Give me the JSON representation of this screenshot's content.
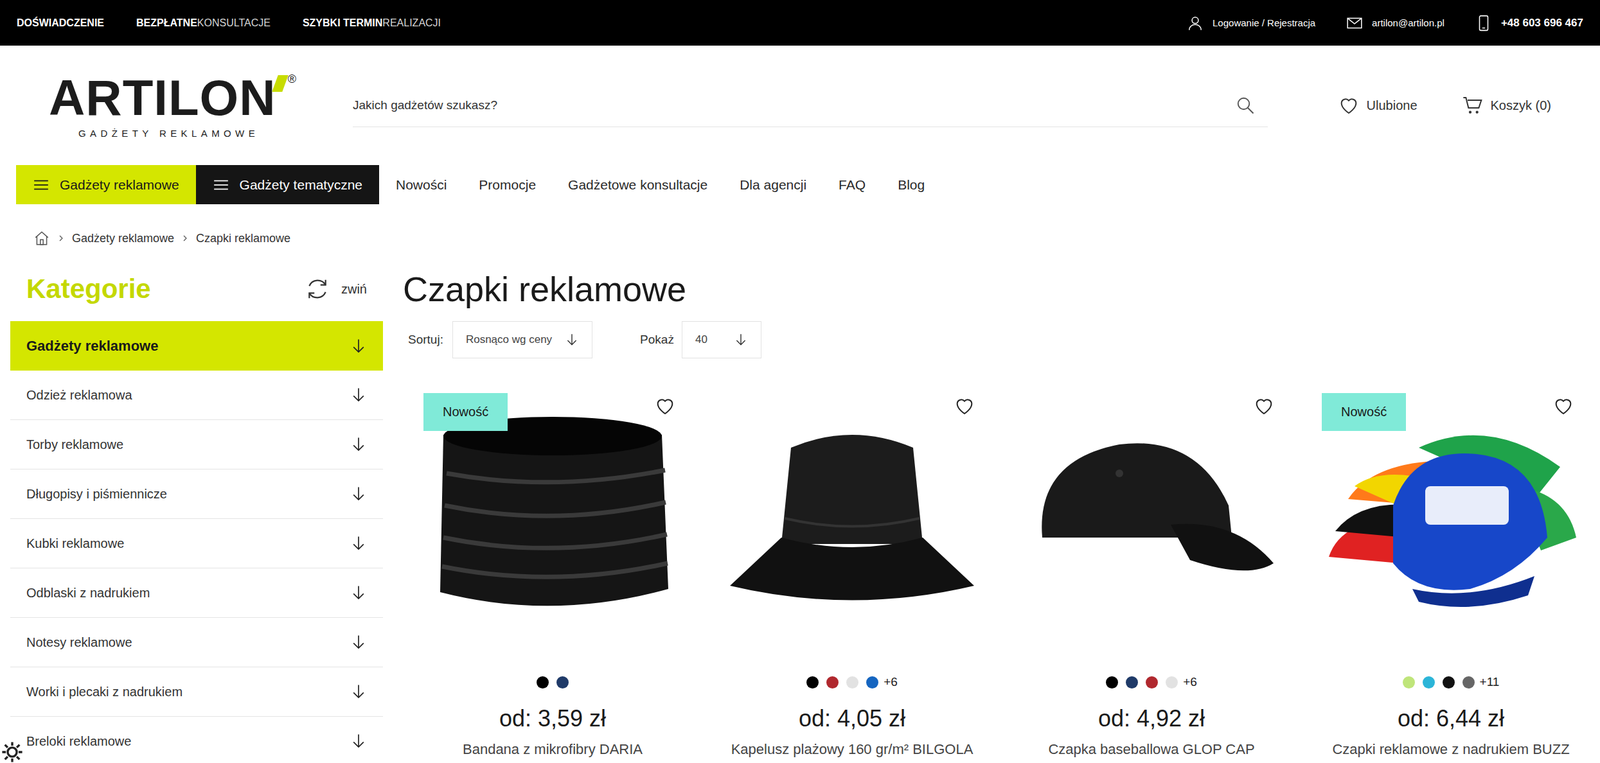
{
  "topbar": {
    "highlights": [
      {
        "bold": "DOŚWIADCZENIE"
      },
      {
        "bold": "BEZPŁATNE",
        "light": "KONSULTACJE"
      },
      {
        "bold": "SZYBKI TERMIN",
        "light": "REALIZACJI"
      }
    ],
    "login": "Logowanie / Rejestracja",
    "email": "artilon@artilon.pl",
    "phone": "+48 603 696 467"
  },
  "logo": {
    "name": "ARTILON",
    "mark": "®",
    "tagline": "GADŻETY REKLAMOWE"
  },
  "search": {
    "placeholder": "Jakich gadżetów szukasz?"
  },
  "header_actions": {
    "favorites": "Ulubione",
    "cart": "Koszyk (0)"
  },
  "nav": {
    "menus": [
      {
        "label": "Gadżety reklamowe",
        "kind": "lime"
      },
      {
        "label": "Gadżety tematyczne",
        "kind": "dark"
      }
    ],
    "links": [
      "Nowości",
      "Promocje",
      "Gadżetowe konsultacje",
      "Dla agencji",
      "FAQ",
      "Blog"
    ]
  },
  "breadcrumb": [
    "Gadżety reklamowe",
    "Czapki reklamowe"
  ],
  "sidebar": {
    "title": "Kategorie",
    "collapse": "zwiń",
    "items": [
      {
        "label": "Gadżety reklamowe",
        "selected": true
      },
      {
        "label": "Odzież reklamowa",
        "selected": false
      },
      {
        "label": "Torby reklamowe",
        "selected": false
      },
      {
        "label": "Długopisy i piśmiennicze",
        "selected": false
      },
      {
        "label": "Kubki reklamowe",
        "selected": false
      },
      {
        "label": "Odblaski z nadrukiem",
        "selected": false
      },
      {
        "label": "Notesy reklamowe",
        "selected": false
      },
      {
        "label": "Worki i plecaki z nadrukiem",
        "selected": false
      },
      {
        "label": "Breloki reklamowe",
        "selected": false
      }
    ]
  },
  "page_title": "Czapki reklamowe",
  "sort": {
    "label": "Sortuj:",
    "value": "Rosnąco wg ceny"
  },
  "show": {
    "label": "Pokaż",
    "value": "40"
  },
  "products": [
    {
      "name": "Bandana z mikrofibry DARIA",
      "price": "od: 3,59 zł",
      "badge": "Nowość",
      "favorite": false,
      "kind": "bandana",
      "colors": [
        "#000000",
        "#1f3a68"
      ],
      "more": null
    },
    {
      "name": "Kapelusz plażowy 160 gr/m² BILGOLA",
      "price": "od: 4,05 zł",
      "badge": null,
      "favorite": false,
      "kind": "bucket-hat",
      "colors": [
        "#000000",
        "#b0282e",
        "#e2e2e2",
        "#1565c0"
      ],
      "more": "+6"
    },
    {
      "name": "Czapka baseballowa GLOP CAP",
      "price": "od: 4,92 zł",
      "badge": null,
      "favorite": false,
      "kind": "cap",
      "colors": [
        "#000000",
        "#1f3a68",
        "#b0282e",
        "#e2e2e2"
      ],
      "more": "+6"
    },
    {
      "name": "Czapki reklamowe z nadrukiem BUZZ",
      "price": "od: 6,44 zł",
      "badge": "Nowość",
      "favorite": false,
      "kind": "caps-set",
      "colors": [
        "#bfe57a",
        "#2cb5d8",
        "#111111",
        "#666666"
      ],
      "more": "+11"
    }
  ]
}
